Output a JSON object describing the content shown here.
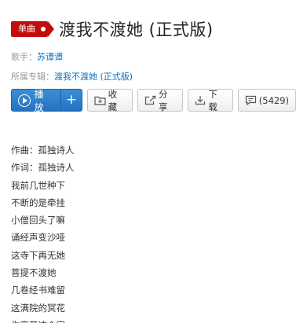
{
  "tag": {
    "label": "单曲",
    "color": "#c20c0c"
  },
  "song": {
    "title": "渡我不渡她 (正式版)"
  },
  "meta": {
    "singer_label": "歌手：",
    "singer": "苏谭谭",
    "album_label": "所属专辑：",
    "album": "渡我不渡她 (正式版)"
  },
  "toolbar": {
    "play_label": "播放",
    "add_label": "+",
    "collect_label": "收藏",
    "share_label": "分享",
    "download_label": "下载",
    "comment_label": "(5429)"
  },
  "icons": {
    "play": "play-circle-icon",
    "collect": "folder-plus-icon",
    "share": "share-icon",
    "download": "download-icon",
    "comment": "comment-icon"
  },
  "lyrics": [
    "作曲：孤独诗人",
    "作词：孤独诗人",
    "我前几世种下",
    "不断的是牵挂",
    "小僧回头了嘛",
    "诵经声变沙哑",
    "这寺下再无她",
    "菩提不渡她",
    "几卷经书难留",
    "这满院的冥花",
    "你离开这个家"
  ]
}
